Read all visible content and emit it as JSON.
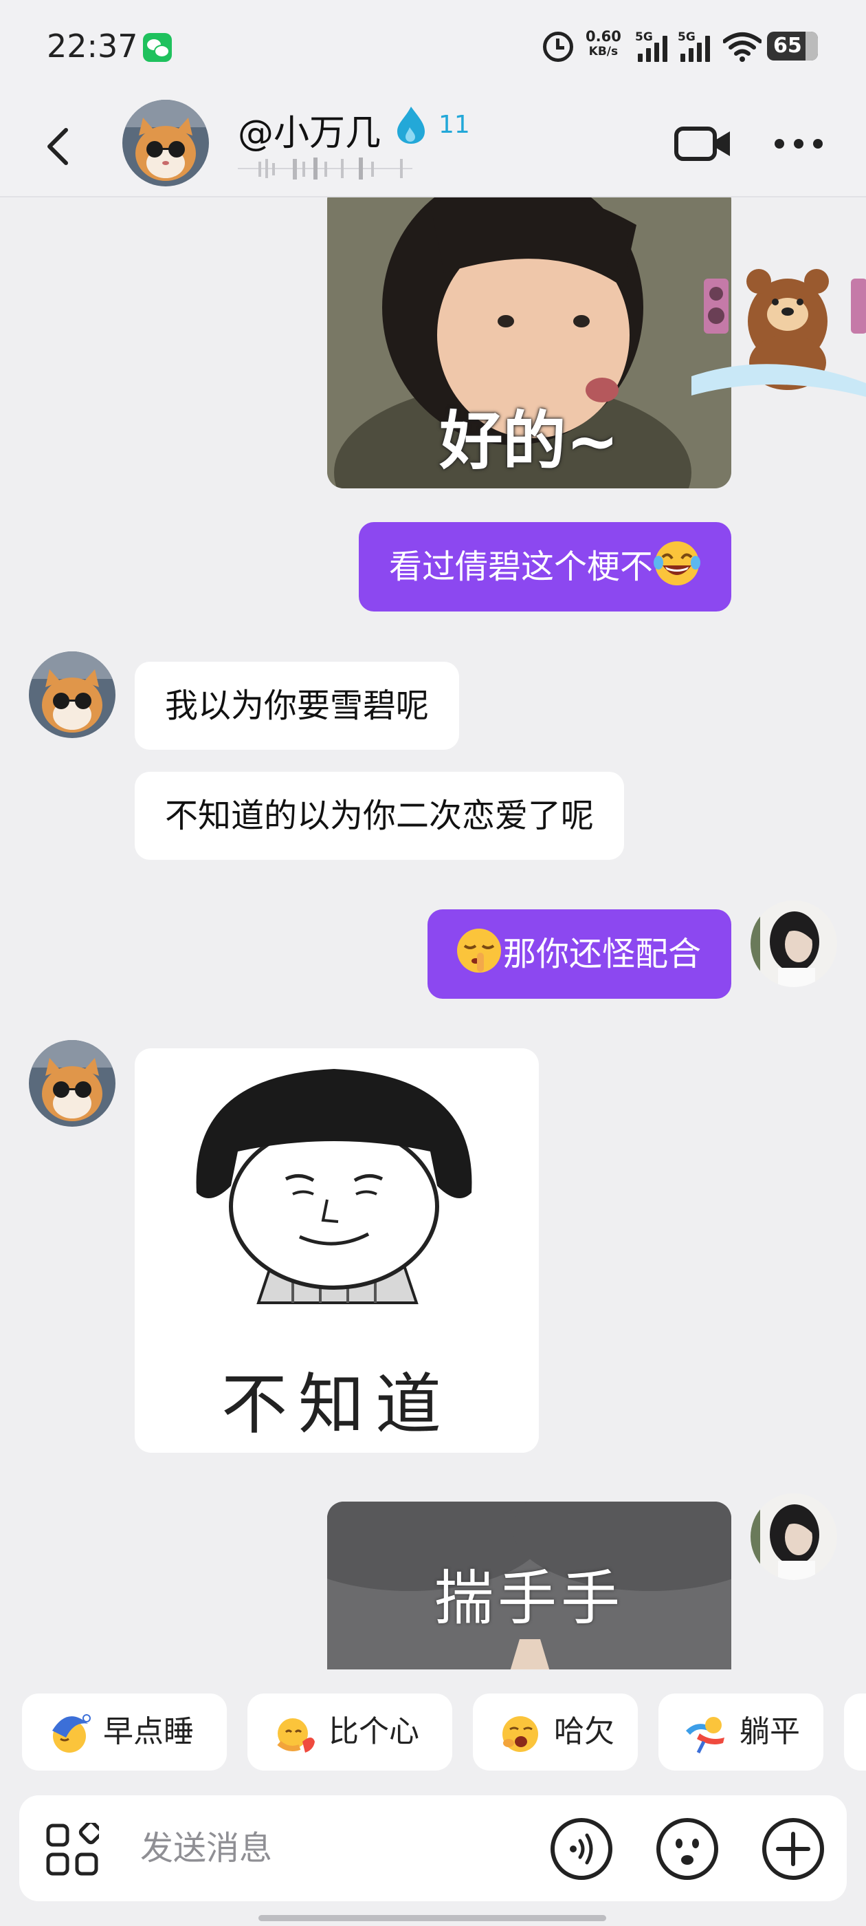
{
  "status_bar": {
    "time": "22:37",
    "net_speed_value": "0.60",
    "net_speed_unit": "KB/s",
    "sim1_label": "5G",
    "sim2_label": "5G",
    "battery_level": "65",
    "icons": [
      "wechat-icon",
      "alarm-icon",
      "signal-icon",
      "signal-icon",
      "wifi-icon",
      "battery-icon"
    ]
  },
  "header": {
    "contact_name": "@小万几",
    "streak_count": "11",
    "icons": [
      "back-icon",
      "flame-icon",
      "video-call-icon",
      "more-icon"
    ]
  },
  "messages": [
    {
      "side": "me",
      "kind": "sticker",
      "caption": "好的~"
    },
    {
      "side": "me",
      "kind": "text",
      "text": "看过倩碧这个梗不",
      "emoji": "laughing-tears"
    },
    {
      "side": "them",
      "kind": "text",
      "text": "我以为你要雪碧呢"
    },
    {
      "side": "them",
      "kind": "text",
      "text": "不知道的以为你二次恋爱了呢"
    },
    {
      "side": "me",
      "kind": "text",
      "text": "那你还怪配合",
      "emoji": "shushing-face"
    },
    {
      "side": "them",
      "kind": "sticker",
      "caption": "不知道"
    },
    {
      "side": "me",
      "kind": "sticker",
      "caption": "揣手手"
    }
  ],
  "quick_replies": [
    {
      "label": "早点睡",
      "icon": "sleepy-moon-icon"
    },
    {
      "label": "比个心",
      "icon": "heart-hands-icon"
    },
    {
      "label": "哈欠",
      "icon": "yawn-face-icon"
    },
    {
      "label": "躺平",
      "icon": "lying-flat-icon"
    }
  ],
  "input": {
    "placeholder": "发送消息",
    "icons": [
      "apps-icon",
      "voice-icon",
      "emoji-icon",
      "plus-icon"
    ]
  },
  "colors": {
    "my_bubble": "#8c48f0",
    "their_bubble": "#ffffff",
    "background": "#efeff1",
    "streak": "#23a8d8"
  }
}
